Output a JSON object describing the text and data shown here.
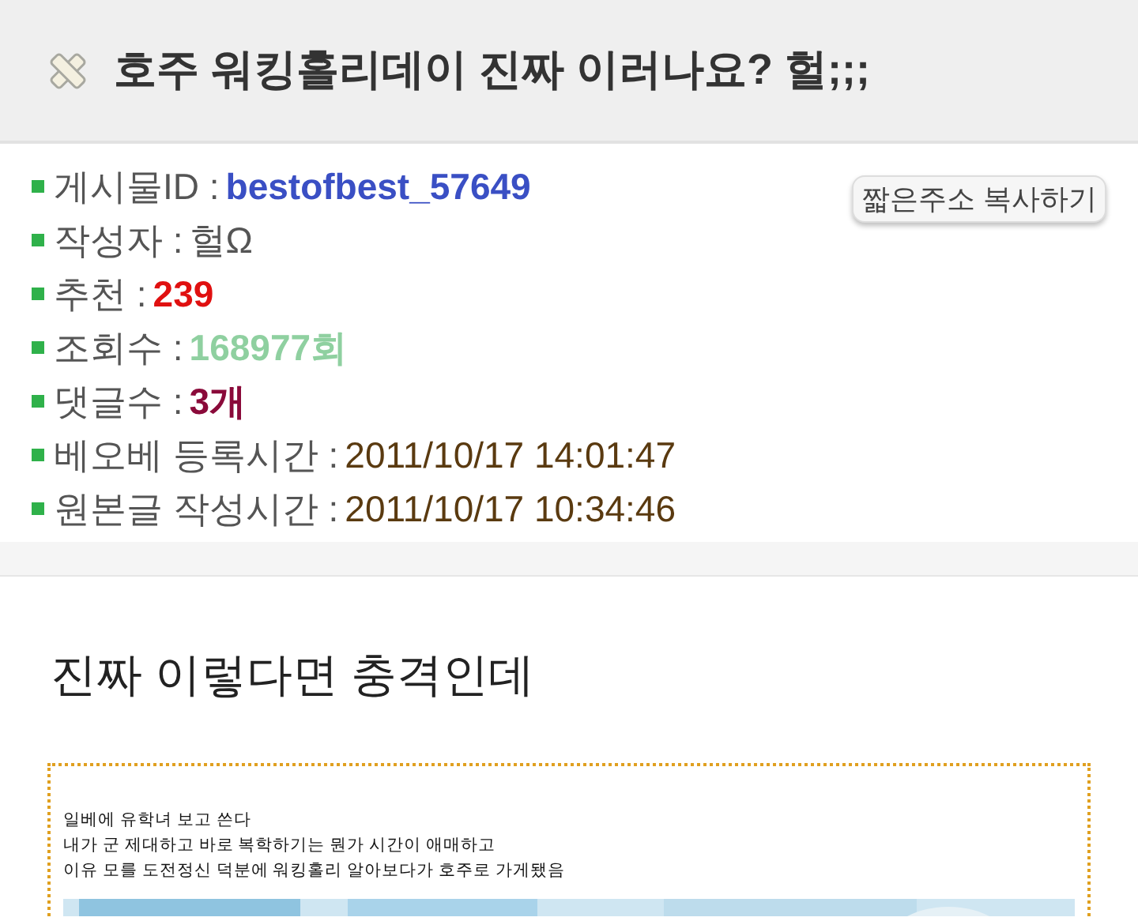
{
  "header": {
    "title": "호주 워킹홀리데이 진짜 이러나요? 헐;;;"
  },
  "info": {
    "copy_button": "짧은주소 복사하기",
    "items": [
      {
        "label": "게시물ID :",
        "value": "bestofbest_57649",
        "kind": "strong",
        "color": "#3a4fc4"
      },
      {
        "label": "작성자 :",
        "value": "헐Ω",
        "kind": "plain",
        "color": "#555555"
      },
      {
        "label": "추천 :",
        "value": "239",
        "kind": "strong",
        "color": "#e01010"
      },
      {
        "label": "조회수 :",
        "value": "168977회",
        "kind": "strong",
        "color": "#8fd0a0"
      },
      {
        "label": "댓글수 :",
        "value": "3개",
        "kind": "strong",
        "color": "#8a0a3a"
      },
      {
        "label": "베오베 등록시간 :",
        "value": "2011/10/17 14:01:47",
        "kind": "plain",
        "color": "#5a3a10"
      },
      {
        "label": "원본글 작성시간 :",
        "value": "2011/10/17 10:34:46",
        "kind": "plain",
        "color": "#5a3a10"
      }
    ]
  },
  "post": {
    "heading": "진짜 이렇다면 충격인데",
    "image_lines": [
      "일베에 유학녀 보고 쓴다",
      "내가 군 제대하고 바로 복학하기는 뭔가 시간이 애매하고",
      "이유 모를 도전정신 덕분에 워킹홀리 알아보다가 호주로 가게됐음"
    ]
  }
}
